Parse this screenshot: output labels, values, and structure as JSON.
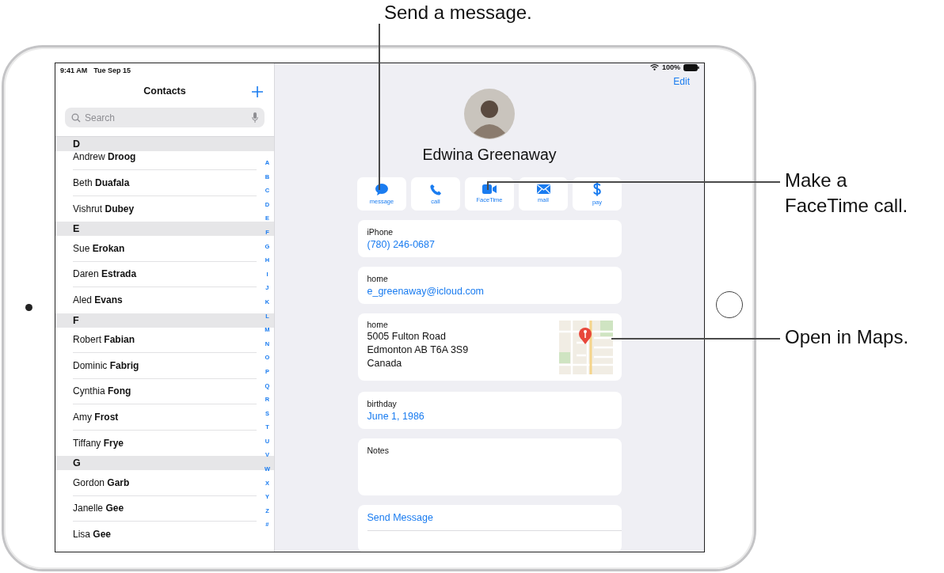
{
  "callouts": [
    {
      "text": "Send a message."
    },
    {
      "text": "Make a\nFaceTime call."
    },
    {
      "text": "Open in Maps."
    }
  ],
  "status_bar": {
    "time": "9:41 AM",
    "date": "Tue Sep 15",
    "battery": "100%"
  },
  "sidebar": {
    "title": "Contacts",
    "search": {
      "placeholder": "Search"
    },
    "sections": [
      {
        "letter": "D",
        "contacts": [
          "Andrew **Droog**",
          "Beth **Duafala**",
          "Vishrut **Dubey**"
        ]
      },
      {
        "letter": "E",
        "contacts": [
          "Sue **Erokan**",
          "Daren **Estrada**",
          "Aled **Evans**"
        ]
      },
      {
        "letter": "F",
        "contacts": [
          "Robert **Fabian**",
          "Dominic **Fabrig**",
          "Cynthia **Fong**",
          "Amy **Frost**",
          "Tiffany **Frye**"
        ]
      },
      {
        "letter": "G",
        "contacts": [
          "Gordon **Garb**",
          "Janelle **Gee**",
          "Lisa **Gee**"
        ]
      }
    ],
    "index": [
      "A",
      "B",
      "C",
      "D",
      "E",
      "F",
      "G",
      "H",
      "I",
      "J",
      "K",
      "L",
      "M",
      "N",
      "O",
      "P",
      "Q",
      "R",
      "S",
      "T",
      "U",
      "V",
      "W",
      "X",
      "Y",
      "Z",
      "#"
    ]
  },
  "detail": {
    "edit": "Edit",
    "name": "Edwina Greenaway",
    "actions": [
      {
        "kind": "message",
        "label": "message"
      },
      {
        "kind": "call",
        "label": "call"
      },
      {
        "kind": "facetime",
        "label": "FaceTime"
      },
      {
        "kind": "mail",
        "label": "mail"
      },
      {
        "kind": "pay",
        "label": "pay"
      }
    ],
    "cards": [
      {
        "kind": "link",
        "label": "iPhone",
        "value": "(780) 246-0687"
      },
      {
        "kind": "link",
        "label": "home",
        "value": "e_greenaway@icloud.com"
      },
      {
        "kind": "address",
        "label": "home",
        "lines": [
          "5005 Fulton Road",
          "Edmonton AB T6A 3S9",
          "Canada"
        ]
      },
      {
        "kind": "link",
        "label": "birthday",
        "value": "June 1, 1986"
      },
      {
        "kind": "notes",
        "label": "Notes"
      },
      {
        "kind": "action",
        "value": "Send Message"
      }
    ]
  }
}
